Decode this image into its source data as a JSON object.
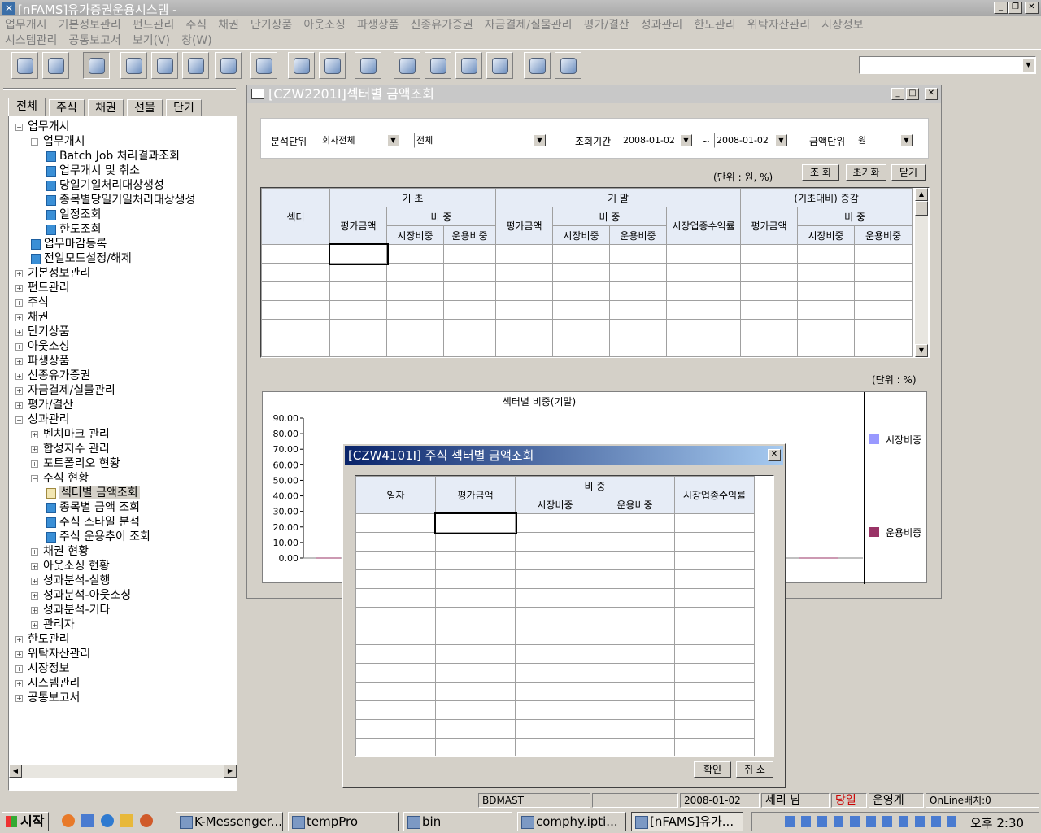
{
  "app": {
    "title": "[nFAMS]유가증권운용시스템 -"
  },
  "menu": {
    "row1": [
      "업무개시",
      "기본정보관리",
      "펀드관리",
      "주식",
      "채권",
      "단기상품",
      "아웃소싱",
      "파생상품",
      "신종유가증권",
      "자금결제/실물관리",
      "평가/결산",
      "성과관리",
      "한도관리",
      "위탁자산관리",
      "시장정보"
    ],
    "row2": [
      "시스템관리",
      "공통보고서",
      "보기(V)",
      "창(W)"
    ]
  },
  "toolbar": {
    "icons": [
      "lock-user",
      "eraser",
      "exit",
      "globe",
      "calculator",
      "books",
      "clock-doc",
      "people",
      "alarm",
      "dice",
      "search",
      "box1",
      "box2",
      "document",
      "help",
      "lock",
      "user-lock"
    ],
    "right_combo": ""
  },
  "left": {
    "tabs": [
      "전체",
      "주식",
      "채권",
      "선물",
      "단기"
    ],
    "tree": [
      {
        "label": "업무개시",
        "level": 0,
        "type": "root",
        "expanded": true
      },
      {
        "label": "업무개시",
        "level": 1,
        "type": "folder",
        "expanded": true
      },
      {
        "label": "Batch Job 처리결과조회",
        "level": 2,
        "type": "book"
      },
      {
        "label": "업무개시 및 취소",
        "level": 2,
        "type": "book"
      },
      {
        "label": "당일기일처리대상생성",
        "level": 2,
        "type": "book"
      },
      {
        "label": "종목별당일기일처리대상생성",
        "level": 2,
        "type": "book"
      },
      {
        "label": "일정조회",
        "level": 2,
        "type": "book"
      },
      {
        "label": "한도조회",
        "level": 2,
        "type": "book"
      },
      {
        "label": "업무마감등록",
        "level": 1,
        "type": "book"
      },
      {
        "label": "전일모드설정/해제",
        "level": 1,
        "type": "book"
      },
      {
        "label": "기본정보관리",
        "level": 0,
        "type": "root"
      },
      {
        "label": "펀드관리",
        "level": 0,
        "type": "root"
      },
      {
        "label": "주식",
        "level": 0,
        "type": "root"
      },
      {
        "label": "채권",
        "level": 0,
        "type": "root"
      },
      {
        "label": "단기상품",
        "level": 0,
        "type": "root"
      },
      {
        "label": "아웃소싱",
        "level": 0,
        "type": "root"
      },
      {
        "label": "파생상품",
        "level": 0,
        "type": "root"
      },
      {
        "label": "신종유가증권",
        "level": 0,
        "type": "root"
      },
      {
        "label": "자금결제/실물관리",
        "level": 0,
        "type": "root"
      },
      {
        "label": "평가/결산",
        "level": 0,
        "type": "root"
      },
      {
        "label": "성과관리",
        "level": 0,
        "type": "root",
        "expanded": true
      },
      {
        "label": "벤치마크 관리",
        "level": 1,
        "type": "folder"
      },
      {
        "label": "합성지수 관리",
        "level": 1,
        "type": "folder"
      },
      {
        "label": "포트폴리오 현황",
        "level": 1,
        "type": "folder"
      },
      {
        "label": "주식 현황",
        "level": 1,
        "type": "folder",
        "expanded": true
      },
      {
        "label": "섹터별 금액조회",
        "level": 2,
        "type": "open",
        "selected": true
      },
      {
        "label": "종목별 금액 조회",
        "level": 2,
        "type": "book"
      },
      {
        "label": "주식 스타일 분석",
        "level": 2,
        "type": "book"
      },
      {
        "label": "주식 운용추이 조회",
        "level": 2,
        "type": "book"
      },
      {
        "label": "채권 현황",
        "level": 1,
        "type": "folder"
      },
      {
        "label": "아웃소싱 현황",
        "level": 1,
        "type": "folder"
      },
      {
        "label": "성과분석-실행",
        "level": 1,
        "type": "folder"
      },
      {
        "label": "성과분석-아웃소싱",
        "level": 1,
        "type": "folder"
      },
      {
        "label": "성과분석-기타",
        "level": 1,
        "type": "folder"
      },
      {
        "label": "관리자",
        "level": 1,
        "type": "folder"
      },
      {
        "label": "한도관리",
        "level": 0,
        "type": "root"
      },
      {
        "label": "위탁자산관리",
        "level": 0,
        "type": "root"
      },
      {
        "label": "시장정보",
        "level": 0,
        "type": "root"
      },
      {
        "label": "시스템관리",
        "level": 0,
        "type": "root"
      },
      {
        "label": "공통보고서",
        "level": 0,
        "type": "root"
      }
    ]
  },
  "main": {
    "title": "[CZW2201I]섹터별 금액조회",
    "filters": {
      "unit_label": "분석단위",
      "unit_value": "회사전체",
      "scope_value": "전체",
      "period_label": "조회기간",
      "date_from": "2008-01-02",
      "date_sep": "~",
      "date_to": "2008-01-02",
      "amount_label": "금액단위",
      "amount_value": "원"
    },
    "unit_note": "(단위 : 원, %)",
    "buttons": {
      "search": "조 회",
      "reset": "초기화",
      "close": "닫기"
    },
    "table": {
      "sector": "섹터",
      "begin": "기      초",
      "end": "기      말",
      "change": "(기초대비) 증감",
      "eval": "평가금액",
      "weight": "비    중",
      "market": "시장비중",
      "manage": "운용비중",
      "industry_return": "시장업종수익률"
    },
    "chart_unit": "(단위 : %)"
  },
  "chart_data": {
    "type": "bar",
    "title": "섹터별 비중(기말)",
    "yticks": [
      "90.00",
      "80.00",
      "70.00",
      "60.00",
      "50.00",
      "40.00",
      "30.00",
      "20.00",
      "10.00",
      "0.00"
    ],
    "ylim": [
      0,
      90
    ],
    "categories": [],
    "series": [
      {
        "name": "시장비중",
        "color": "#9999ff",
        "values": []
      },
      {
        "name": "운용비중",
        "color": "#993366",
        "values": []
      }
    ],
    "legend": "right"
  },
  "dialog": {
    "title": "[CZW4101I] 주식 섹터별 금액조회",
    "cols": {
      "date": "일자",
      "eval": "평가금액",
      "weight": "비  중",
      "market": "시장비중",
      "manage": "운용비중",
      "industry_return": "시장업종수익률"
    },
    "ok": "확인",
    "cancel": "취 소"
  },
  "status": {
    "server": "BDMAST",
    "date": "2008-01-02",
    "user": "세리 님",
    "today": "당일",
    "mode": "운영계",
    "batch": "OnLine배치:0"
  },
  "taskbar": {
    "start": "시작",
    "tasks": [
      "K-Messenger...",
      "tempPro",
      "bin",
      "comphy.ipti...",
      "[nFAMS]유가..."
    ],
    "clock": "오후 2:30"
  },
  "colors": {
    "accent": "#0a246a",
    "header_bg": "#e6ecf6",
    "today": "#cc0000"
  }
}
